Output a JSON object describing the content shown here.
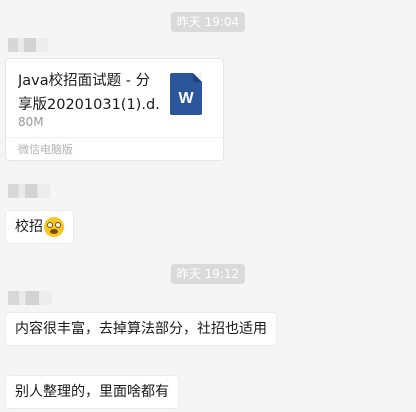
{
  "messages": {
    "timestamp_1": "昨天 19:04",
    "file": {
      "name_line1": "Java校招面试题 - 分",
      "name_line2": "享版20201031(1).d...",
      "size": "80M",
      "source": "微信电脑版",
      "icon": "W"
    },
    "msg1_text": "校招",
    "timestamp_2": "昨天 19:12",
    "msg2_text": "内容很丰富，去掉算法部分，社招也适用",
    "msg3_text": "别人整理的，里面啥都有"
  }
}
